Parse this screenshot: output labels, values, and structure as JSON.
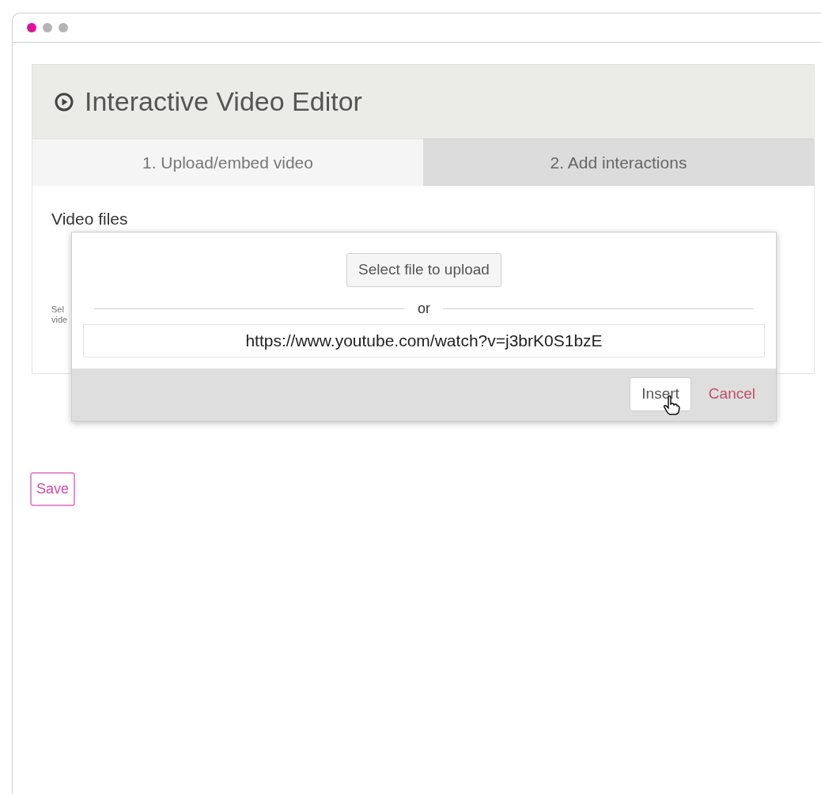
{
  "window": {
    "controls": [
      {
        "color": "#e0109a"
      },
      {
        "color": "#b4b4b4"
      },
      {
        "color": "#b4b4b4"
      }
    ]
  },
  "editor": {
    "title": "Interactive Video Editor",
    "tabs": [
      {
        "label": "1. Upload/embed video",
        "selected": true
      },
      {
        "label": "2. Add interactions",
        "selected": false
      }
    ],
    "section_title": "Video files",
    "hint_lines": [
      "Sel",
      "vide"
    ]
  },
  "dialog": {
    "upload_button": "Select file to upload",
    "separator": "or",
    "url": "https://www.youtube.com/watch?v=j3brK0S1bzE",
    "insert_button": "Insert",
    "cancel_link": "Cancel"
  },
  "save_button": "Save"
}
